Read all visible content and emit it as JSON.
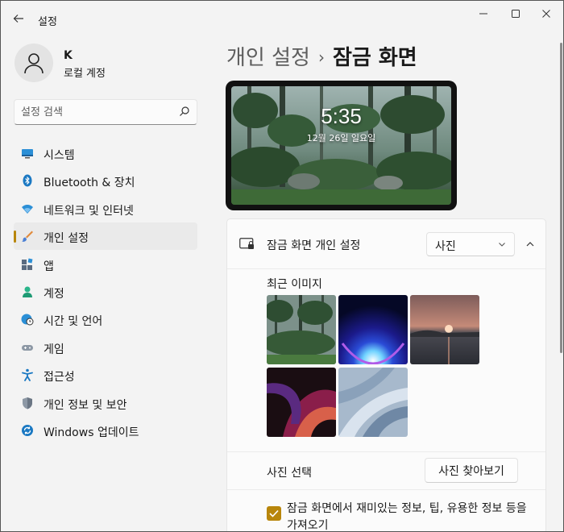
{
  "window": {
    "title": "설정"
  },
  "account": {
    "initial": "K",
    "type": "로컬 계정"
  },
  "search": {
    "placeholder": "설정 검색"
  },
  "sidebar": {
    "items": [
      {
        "label": "시스템",
        "icon": "monitor-icon"
      },
      {
        "label": "Bluetooth & 장치",
        "icon": "bluetooth-icon"
      },
      {
        "label": "네트워크 및 인터넷",
        "icon": "wifi-icon"
      },
      {
        "label": "개인 설정",
        "icon": "brush-icon",
        "active": true
      },
      {
        "label": "앱",
        "icon": "apps-icon"
      },
      {
        "label": "계정",
        "icon": "person-icon"
      },
      {
        "label": "시간 및 언어",
        "icon": "globe-clock-icon"
      },
      {
        "label": "게임",
        "icon": "gamepad-icon"
      },
      {
        "label": "접근성",
        "icon": "accessibility-icon"
      },
      {
        "label": "개인 정보 및 보안",
        "icon": "shield-icon"
      },
      {
        "label": "Windows 업데이트",
        "icon": "update-icon"
      }
    ]
  },
  "main": {
    "breadcrumb_parent": "개인 설정",
    "breadcrumb_sep": "›",
    "breadcrumb_current": "잠금 화면",
    "preview": {
      "time": "5:35",
      "date": "12월 26일 일요일"
    },
    "card": {
      "title": "잠금 화면 개인 설정",
      "dropdown_value": "사진",
      "recent_label": "최근 이미지",
      "photo_select_label": "사진 선택",
      "browse_label": "사진 찾아보기",
      "checkbox_label": "잠금 화면에서 재미있는 정보, 팁, 유용한 정보 등을 가져오기",
      "checkbox_checked": true
    }
  },
  "colors": {
    "accent": "#b8860b"
  }
}
